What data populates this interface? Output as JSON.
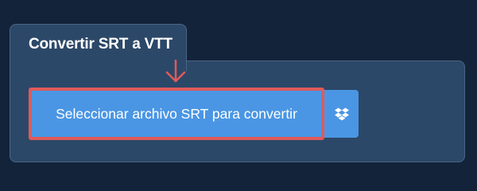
{
  "tab": {
    "title": "Convertir SRT a VTT"
  },
  "upload": {
    "select_label": "Seleccionar archivo SRT para convertir",
    "dropbox_icon": "dropbox-icon"
  },
  "annotation": {
    "arrow_icon": "down-arrow-icon",
    "highlight_color": "#e05a5a"
  },
  "colors": {
    "background": "#13233a",
    "panel": "#2c4868",
    "button": "#4a96e4"
  }
}
